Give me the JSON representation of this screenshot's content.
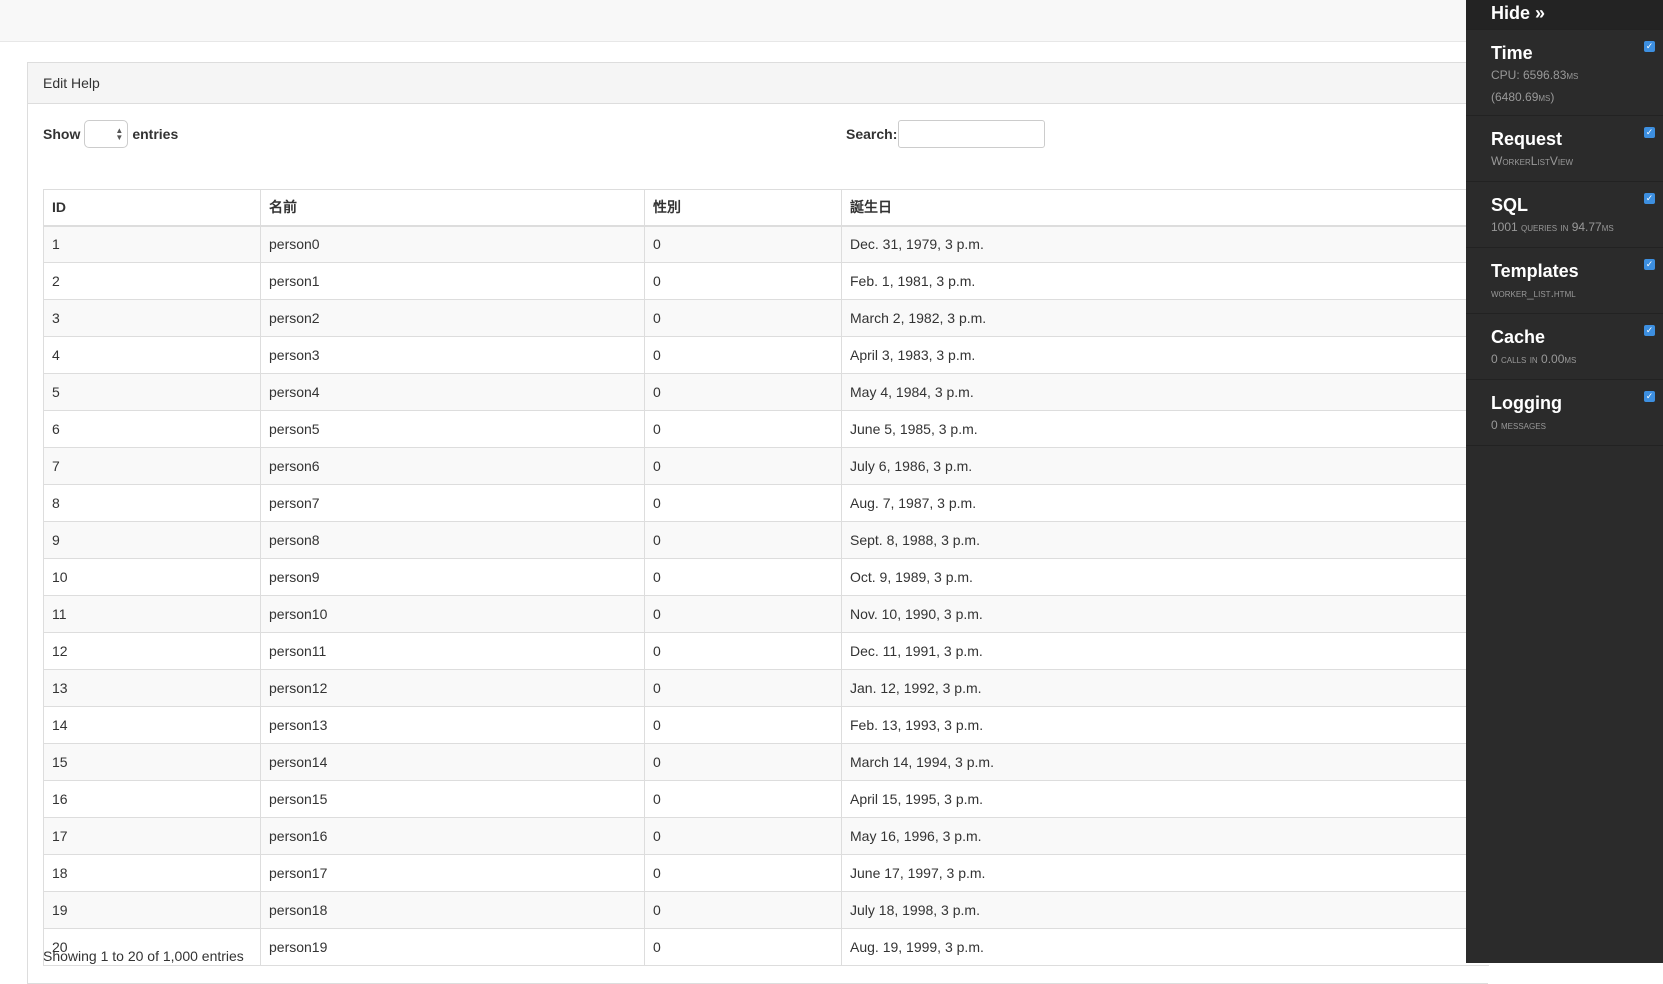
{
  "panel": {
    "heading": "Edit Help"
  },
  "controls": {
    "show_label": "Show",
    "entries_label": "entries",
    "search_label": "Search:",
    "search_value": ""
  },
  "table": {
    "columns": [
      "ID",
      "名前",
      "性別",
      "誕生日"
    ],
    "rows": [
      [
        "1",
        "person0",
        "0",
        "Dec. 31, 1979, 3 p.m."
      ],
      [
        "2",
        "person1",
        "0",
        "Feb. 1, 1981, 3 p.m."
      ],
      [
        "3",
        "person2",
        "0",
        "March 2, 1982, 3 p.m."
      ],
      [
        "4",
        "person3",
        "0",
        "April 3, 1983, 3 p.m."
      ],
      [
        "5",
        "person4",
        "0",
        "May 4, 1984, 3 p.m."
      ],
      [
        "6",
        "person5",
        "0",
        "June 5, 1985, 3 p.m."
      ],
      [
        "7",
        "person6",
        "0",
        "July 6, 1986, 3 p.m."
      ],
      [
        "8",
        "person7",
        "0",
        "Aug. 7, 1987, 3 p.m."
      ],
      [
        "9",
        "person8",
        "0",
        "Sept. 8, 1988, 3 p.m."
      ],
      [
        "10",
        "person9",
        "0",
        "Oct. 9, 1989, 3 p.m."
      ],
      [
        "11",
        "person10",
        "0",
        "Nov. 10, 1990, 3 p.m."
      ],
      [
        "12",
        "person11",
        "0",
        "Dec. 11, 1991, 3 p.m."
      ],
      [
        "13",
        "person12",
        "0",
        "Jan. 12, 1992, 3 p.m."
      ],
      [
        "14",
        "person13",
        "0",
        "Feb. 13, 1993, 3 p.m."
      ],
      [
        "15",
        "person14",
        "0",
        "March 14, 1994, 3 p.m."
      ],
      [
        "16",
        "person15",
        "0",
        "April 15, 1995, 3 p.m."
      ],
      [
        "17",
        "person16",
        "0",
        "May 16, 1996, 3 p.m."
      ],
      [
        "18",
        "person17",
        "0",
        "June 17, 1997, 3 p.m."
      ],
      [
        "19",
        "person18",
        "0",
        "July 18, 1998, 3 p.m."
      ],
      [
        "20",
        "person19",
        "0",
        "Aug. 19, 1999, 3 p.m."
      ]
    ],
    "info": "Showing 1 to 20 of 1,000 entries"
  },
  "debug_toolbar": {
    "hide_label": "Hide »",
    "panels": [
      {
        "title": "Time",
        "sub": "CPU: 6596.83ms",
        "sub2": "(6480.69ms)"
      },
      {
        "title": "Request",
        "sub": "WorkerListView"
      },
      {
        "title": "SQL",
        "sub": "1001 queries in 94.77ms"
      },
      {
        "title": "Templates",
        "sub": "worker_list.html"
      },
      {
        "title": "Cache",
        "sub": "0 calls in 0.00ms"
      },
      {
        "title": "Logging",
        "sub": "0 messages"
      }
    ]
  }
}
